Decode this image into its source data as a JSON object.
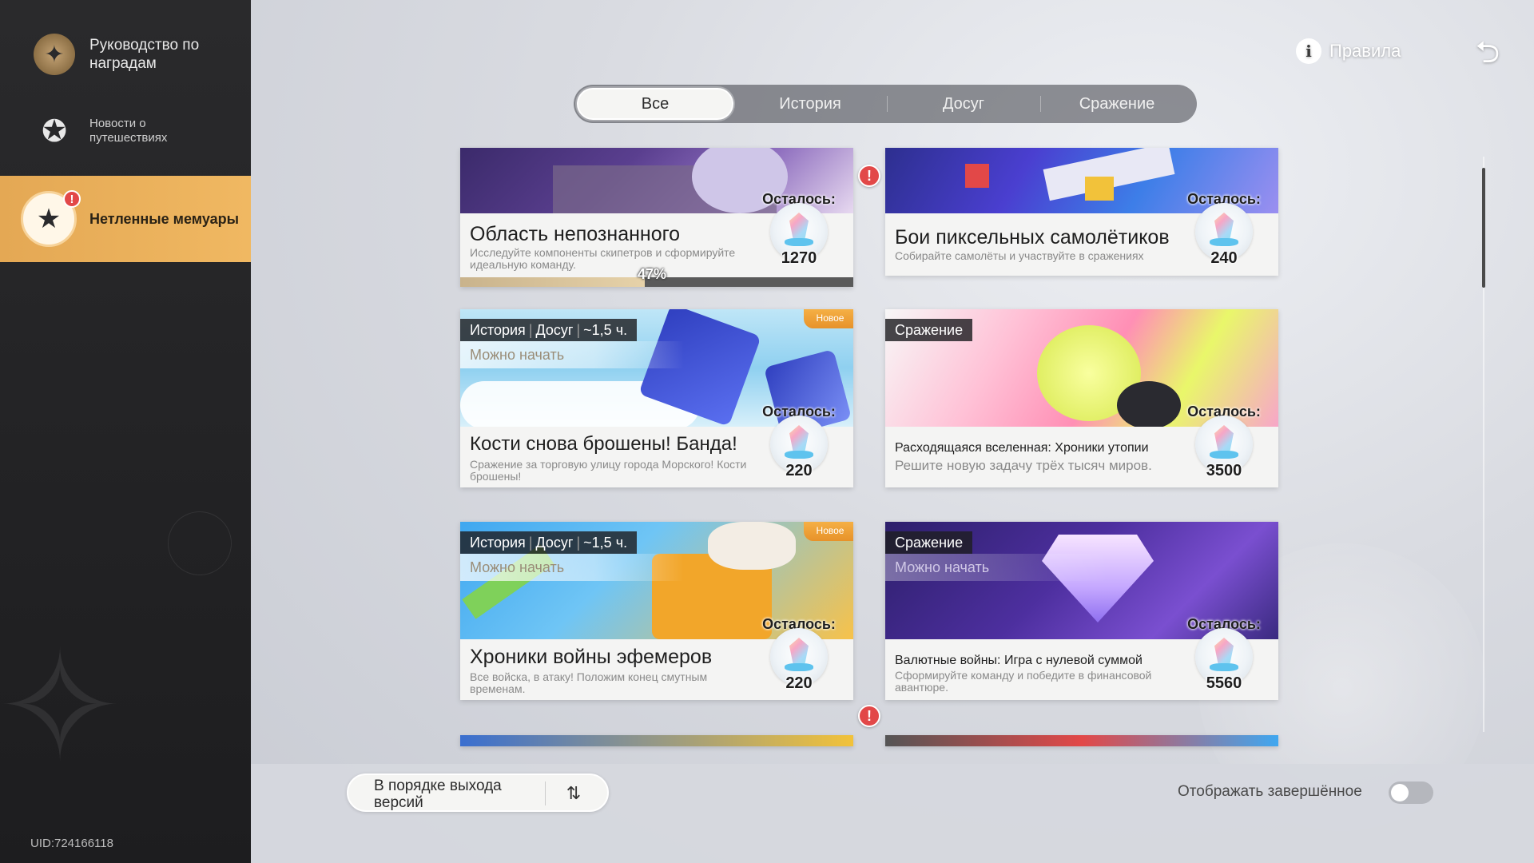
{
  "sidebar": {
    "items": [
      {
        "label": "Руководство по наградам",
        "icon": "compass-star-icon"
      },
      {
        "label": "Новости о путешествиях",
        "icon": "star-orbit-icon"
      },
      {
        "label": "Нетленные мемуары",
        "icon": "memoir-star-icon",
        "active": true,
        "alert": "!"
      }
    ],
    "uid": "UID:724166118"
  },
  "header": {
    "rules_label": "Правила",
    "info_glyph": "i",
    "back_glyph": "⮌"
  },
  "tabs": [
    {
      "label": "Все",
      "active": true
    },
    {
      "label": "История"
    },
    {
      "label": "Досуг"
    },
    {
      "label": "Сражение"
    }
  ],
  "remain_label": "Осталось:",
  "new_label": "Новое",
  "can_start_label": "Можно начать",
  "cards": [
    {
      "title": "Область непознанного",
      "desc": "Исследуйте компоненты скипетров и сформируйте идеальную команду.",
      "remain": "1270",
      "progress_pct": "47%",
      "progress_value": 0.47
    },
    {
      "title": "Бои пиксельных самолётиков",
      "desc": "Собирайте самолёты и участвуйте в сражениях",
      "remain": "240"
    },
    {
      "chip": [
        "История",
        "Досуг",
        "~1,5 ч."
      ],
      "title": "Кости снова брошены! Банда!",
      "desc": "Сражение за торговую улицу города Морского! Кости брошены!",
      "remain": "220"
    },
    {
      "chip": [
        "Сражение"
      ],
      "title": "Расходящаяся вселенная: Хроники утопии",
      "desc": "Решите новую задачу трёх тысяч миров.",
      "remain": "3500"
    },
    {
      "chip": [
        "История",
        "Досуг",
        "~1,5 ч."
      ],
      "title": "Хроники войны эфемеров",
      "desc": "Все войска, в атаку! Положим конец смутным временам.",
      "remain": "220"
    },
    {
      "chip": [
        "Сражение"
      ],
      "title": "Валютные войны: Игра с нулевой суммой",
      "desc": "Сформируйте команду и победите в финансовой авантюре.",
      "remain": "5560"
    }
  ],
  "bottom": {
    "sort_label": "В порядке выхода версий",
    "sort_icon": "⇅",
    "show_completed_label": "Отображать завершённое",
    "show_completed": false
  },
  "colors": {
    "accent": "#f0b862",
    "alert": "#e24848",
    "new_badge": "#e7922a"
  }
}
